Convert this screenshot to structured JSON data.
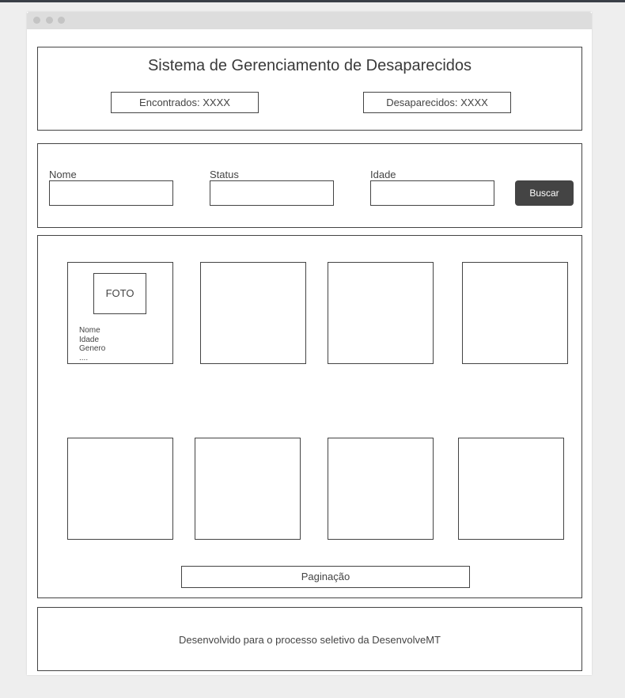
{
  "header": {
    "title": "Sistema de Gerenciamento de Desaparecidos",
    "found_label": "Encontrados: XXXX",
    "missing_label": "Desaparecidos: XXXX"
  },
  "filters": {
    "name_label": "Nome",
    "status_label": "Status",
    "age_label": "Idade",
    "search_button": "Buscar"
  },
  "card": {
    "photo_label": "FOTO",
    "fields": [
      "Nome",
      "Idade",
      "Genero",
      "...."
    ]
  },
  "pagination": {
    "label": "Paginação"
  },
  "footer": {
    "text": "Desenvolvido para o processo seletivo da DesenvolveMT"
  }
}
